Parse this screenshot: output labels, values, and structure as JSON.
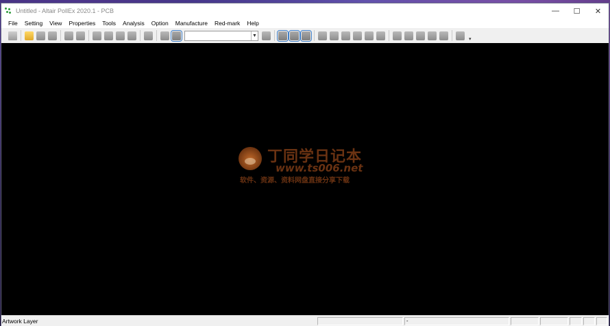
{
  "window": {
    "title": "Untitled - Altair PollEx 2020.1 - PCB",
    "controls": {
      "minimize": "—",
      "maximize": "☐",
      "close": "✕"
    }
  },
  "menu": [
    "File",
    "Setting",
    "View",
    "Properties",
    "Tools",
    "Analysis",
    "Option",
    "Manufacture",
    "Red-mark",
    "Help"
  ],
  "toolbar": {
    "layer_combo_value": "",
    "overflow_chevron": "▾"
  },
  "watermark": {
    "title": "丁同学日记本",
    "url": "www.ts006.net",
    "subtitle": "软件、资源、资料网盘直接分享下载"
  },
  "statusbar": {
    "layer_text": "Artwork Layer",
    "pane_2": "-"
  }
}
